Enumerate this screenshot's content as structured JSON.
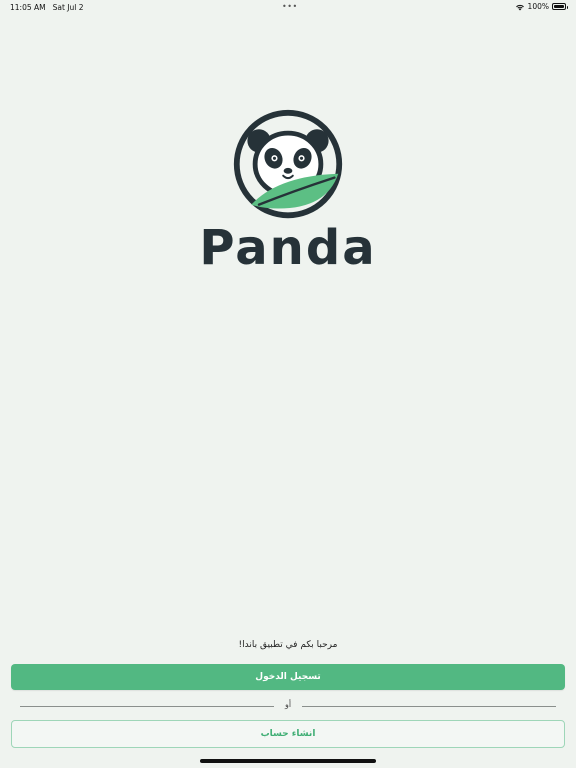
{
  "status_bar": {
    "time": "11:05 AM",
    "date": "Sat Jul 2",
    "battery_text": "100%",
    "wifi_icon": "wifi-icon",
    "battery_icon": "battery-icon"
  },
  "logo": {
    "wordmark": "Panda",
    "icon": "panda-logo-icon"
  },
  "welcome_text": "مرحبا بكم في تطبيق باندا!",
  "login_button_label": "تسجيل الدخول",
  "divider_text": "أو",
  "register_button_label": "انشاء حساب",
  "colors": {
    "primary_green": "#52b882",
    "background": "#eff3ef",
    "logo_dark": "#263238",
    "leaf_green": "#5cbf84"
  }
}
